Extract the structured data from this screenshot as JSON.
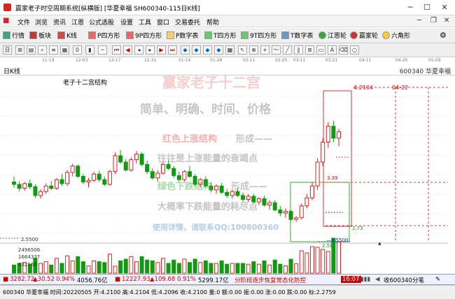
{
  "window": {
    "title": "赢家老子时空周期系统[纵横版]  [华夏幸福  SH600340-115日K线]",
    "min_icon": "minimize-icon",
    "max_icon": "maximize-icon",
    "close_icon": "close-icon"
  },
  "menu": [
    "文件",
    "浏览",
    "资讯",
    "江恩",
    "公式选股",
    "设置",
    "工具",
    "窗口",
    "交易委托",
    "帮助"
  ],
  "toolbar1": [
    "行情",
    "板块",
    "K线",
    "P四方形",
    "9P四方形",
    "P数字表",
    "T四方形",
    "9T四方形",
    "T数字表",
    "江恩轮",
    "赢家轮",
    "六角形"
  ],
  "tabstrip": {
    "k_label": "日K线",
    "stock": "600340  华夏幸福",
    "date_ticks": [
      "11-19",
      "12-03",
      "12-17",
      "12-31",
      "01-14",
      "01-28",
      "02-11",
      "02-25",
      "03-11",
      "03-21",
      "04-11",
      "04-25",
      "05-09"
    ]
  },
  "chart": {
    "caption": "老子十二宫结构",
    "levels": {
      "hi": "4.2104",
      "hi_date": "04-22",
      "p339": "3.39",
      "p273": "2.73",
      "p258": "2.58",
      "lo": "2.5500"
    },
    "axis": {
      "price": "2.5500",
      "vol1": "2496506",
      "vol2": "1664337",
      "vol3": "832169"
    },
    "watermark": {
      "brand": "赢家老子十二宫",
      "l1": "简单、明确、时间、价格",
      "l2a": "红色上涨结构",
      "l2b": "形成——",
      "l3": "往往是上涨能量的衰竭点",
      "l4a": "绿色下跌结构",
      "l4b": "形成——",
      "l5": "大概率下跌能量的耗尽点",
      "l6": "使用详情，请联系QQ:100800360"
    }
  },
  "chart_data": {
    "type": "candlestick",
    "title": "老子十二宫结构",
    "x_ticks": [
      "11-19",
      "12-03",
      "12-17",
      "12-31",
      "01-14",
      "01-28",
      "02-11",
      "02-25",
      "03-11",
      "03-21",
      "04-11",
      "04-25",
      "05-09"
    ],
    "ylim": [
      2.3,
      4.3
    ],
    "candles": [
      [
        3.05,
        3.12,
        2.98,
        3.02
      ],
      [
        3.02,
        3.06,
        2.93,
        2.97
      ],
      [
        2.97,
        3.05,
        2.94,
        3.03
      ],
      [
        3.03,
        3.08,
        2.96,
        2.99
      ],
      [
        2.99,
        3.02,
        2.85,
        2.88
      ],
      [
        2.88,
        2.96,
        2.84,
        2.93
      ],
      [
        2.93,
        3.03,
        2.9,
        3.0
      ],
      [
        3.0,
        3.06,
        2.95,
        2.97
      ],
      [
        2.97,
        3.1,
        2.95,
        3.08
      ],
      [
        3.08,
        3.15,
        3.0,
        3.03
      ],
      [
        3.03,
        3.2,
        3.0,
        3.17
      ],
      [
        3.17,
        3.28,
        3.12,
        3.25
      ],
      [
        3.25,
        3.27,
        3.1,
        3.12
      ],
      [
        3.12,
        3.15,
        3.02,
        3.05
      ],
      [
        3.05,
        3.1,
        2.98,
        3.07
      ],
      [
        3.07,
        3.18,
        3.05,
        3.15
      ],
      [
        3.15,
        3.19,
        3.05,
        3.08
      ],
      [
        3.08,
        3.12,
        3.0,
        3.02
      ],
      [
        3.02,
        3.2,
        3.0,
        3.18
      ],
      [
        3.18,
        3.42,
        3.15,
        3.38
      ],
      [
        3.38,
        3.45,
        3.28,
        3.3
      ],
      [
        3.3,
        3.34,
        3.18,
        3.2
      ],
      [
        3.2,
        3.36,
        3.18,
        3.33
      ],
      [
        3.33,
        3.44,
        3.28,
        3.4
      ],
      [
        3.4,
        3.42,
        3.25,
        3.27
      ],
      [
        3.27,
        3.32,
        3.15,
        3.18
      ],
      [
        3.18,
        3.22,
        3.08,
        3.1
      ],
      [
        3.1,
        3.2,
        3.05,
        3.16
      ],
      [
        3.16,
        3.3,
        3.14,
        3.27
      ],
      [
        3.27,
        3.33,
        3.2,
        3.22
      ],
      [
        3.22,
        3.25,
        3.1,
        3.13
      ],
      [
        3.13,
        3.18,
        3.05,
        3.08
      ],
      [
        3.08,
        3.2,
        3.05,
        3.18
      ],
      [
        3.18,
        3.25,
        3.1,
        3.12
      ],
      [
        3.12,
        3.15,
        3.0,
        3.02
      ],
      [
        3.02,
        3.1,
        2.98,
        3.08
      ],
      [
        3.08,
        3.12,
        2.98,
        3.0
      ],
      [
        3.0,
        3.05,
        2.92,
        2.95
      ],
      [
        2.95,
        3.02,
        2.9,
        3.0
      ],
      [
        3.0,
        3.04,
        2.9,
        2.92
      ],
      [
        2.92,
        2.96,
        2.85,
        2.88
      ],
      [
        2.88,
        2.95,
        2.84,
        2.93
      ],
      [
        2.93,
        2.98,
        2.86,
        2.88
      ],
      [
        2.88,
        2.92,
        2.8,
        2.83
      ],
      [
        2.83,
        2.9,
        2.8,
        2.87
      ],
      [
        2.87,
        2.9,
        2.78,
        2.8
      ],
      [
        2.8,
        2.86,
        2.76,
        2.84
      ],
      [
        2.84,
        2.88,
        2.74,
        2.76
      ],
      [
        2.76,
        2.82,
        2.7,
        2.79
      ],
      [
        2.79,
        2.82,
        2.68,
        2.7
      ],
      [
        2.7,
        2.75,
        2.62,
        2.66
      ],
      [
        2.66,
        2.72,
        2.6,
        2.68
      ],
      [
        2.68,
        2.7,
        2.56,
        2.58
      ],
      [
        2.58,
        2.62,
        2.55,
        2.6
      ],
      [
        2.6,
        2.78,
        2.58,
        2.75
      ],
      [
        2.75,
        2.9,
        2.72,
        2.85
      ],
      [
        2.85,
        3.05,
        2.82,
        3.0
      ],
      [
        3.0,
        3.35,
        2.95,
        3.3
      ],
      [
        3.3,
        3.6,
        3.25,
        3.55
      ],
      [
        3.55,
        3.8,
        3.48,
        3.75
      ],
      [
        3.75,
        3.82,
        3.55,
        3.6
      ],
      [
        3.6,
        3.72,
        3.5,
        3.68
      ]
    ],
    "volume_ticks": [
      "2496506",
      "1664337",
      "832169"
    ]
  },
  "infobar": {
    "sh": "3282.72",
    "sh_chg": "▲30.52",
    "sh_pct": "0.94%",
    "sh_amt": "4056.76亿",
    "sz": "12227.93",
    "sz_chg": "▲109.68",
    "sz_pct": "0.91%",
    "sz_amt": "5299.17亿",
    "scroll": "分阶段逐步恢复常态化防控",
    "time": "16:07",
    "recv": "收600340分笔"
  },
  "statusbar": "600340 华夏幸福 时间:20220505 开:4.2100 高:4.2104 低:4.2096 收:4.2100 量:0 额:0.00 振:0.00 涨:0.00 跌:0.00 标:2.2759"
}
